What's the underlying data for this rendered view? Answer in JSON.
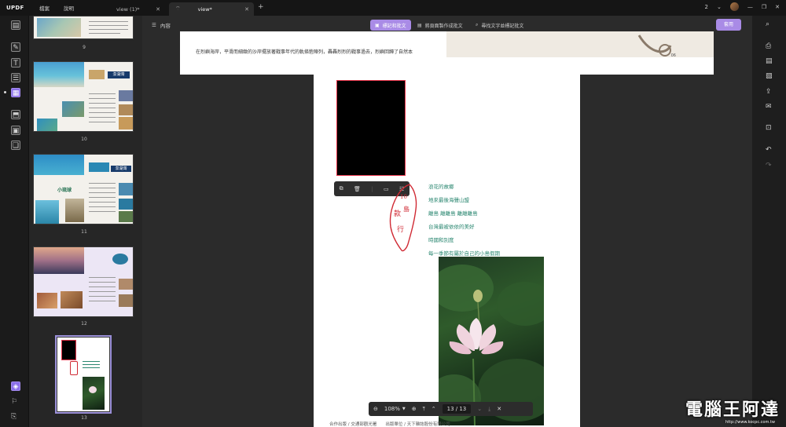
{
  "titlebar": {
    "logo": "UPDF",
    "menu": [
      "檔案",
      "說明"
    ],
    "tabs": [
      {
        "label": "view (1)*"
      },
      {
        "label": "view*"
      }
    ],
    "page_count_badge": "2",
    "new_tab": "+"
  },
  "subtoolbar": {
    "content_label": "內容",
    "modes": [
      "標記和批文",
      "將頁面製作成批文",
      "尋找文字並標記批文"
    ],
    "apply_label": "套用"
  },
  "thumbnails": [
    {
      "page": "9"
    },
    {
      "page": "10",
      "badge": "澎湖灣"
    },
    {
      "page": "11",
      "badge": "澎湖灣",
      "tag": "小琉球"
    },
    {
      "page": "12"
    },
    {
      "page": "13"
    }
  ],
  "document": {
    "prev_page_text": "在烈嶼海岸，平滑而細緻的沙岸擺放著戰事年代的軌條砦陣列，轟轟烈烈的戰事過去，烈嶼回歸了自然本",
    "prev_page_num": "06",
    "poem_lines": [
      "浪花的故鄉",
      "地來最後海聲山盟",
      "離島 離離島 離離離島",
      "台灣最被依依的美好",
      "時國和別度",
      "每一季節有屬於自己的小島假期"
    ],
    "stamp_text": "10 島 款 行",
    "footer": "合作出版 / 交通部觀光署　　出版單位 / 天下雜誌股份有限公司"
  },
  "zoom": {
    "level": "108%",
    "page_indicator": "13 / 13"
  },
  "watermark": {
    "text": "電腦王阿達",
    "url": "http://www.kocpc.com.tw"
  },
  "colors": {
    "accent": "#a98be6",
    "poem": "#2a8770",
    "stamp": "#d02a34"
  }
}
